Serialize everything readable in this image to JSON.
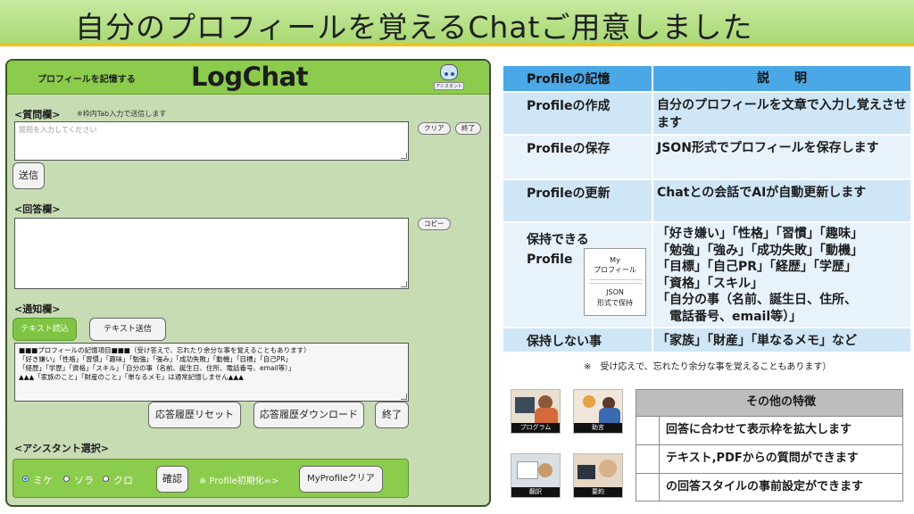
{
  "banner": {
    "title": "自分のプロフィールを覚えるChatご用意しました"
  },
  "app": {
    "subtitle": "プロフィールを記憶する",
    "logo": "LogChat",
    "avatar_tag": "アシスタント",
    "question": {
      "label": "<質問欄>",
      "hint": "※枠内Tab入力で送信します",
      "placeholder": "質問を入力してください",
      "clear_label": "クリア",
      "exit_label": "終了",
      "send_label": "送信"
    },
    "answer": {
      "label": "<回答欄>",
      "copy_label": "コピー"
    },
    "notice": {
      "label": "<通知欄>",
      "tab_read": "テキスト読込",
      "tab_send": "テキスト送信",
      "content_lines": [
        "■■■プロフィールの記憶項目■■■（受け答えで、忘れたり余分な事を覚えることもあります）",
        "「好き嫌い」「性格」「習慣」「趣味」「勉強」「強み」「成功失敗」「動機」「目標」「自己PR」",
        "「経歴」「学歴」「資格」「スキル」「自分の事（名前、誕生日、住所、電話番号、email等）」",
        "▲▲▲「家族のこと」「財産のこと」「単なるメモ」は通常記憶しません▲▲▲"
      ],
      "reset_label": "応答履歴リセット",
      "download_label": "応答履歴ダウンロード",
      "exit_label": "終了"
    },
    "assistant": {
      "label": "<アシスタント選択>",
      "options": [
        "ミケ",
        "ソラ",
        "クロ"
      ],
      "selected": "ミケ",
      "confirm_label": "確認",
      "init_note": "※ Profile初期化=>",
      "clear_label": "MyProfileクリア"
    }
  },
  "profile_table": {
    "header": {
      "col1": "Profileの記憶",
      "col2": "説　　明"
    },
    "rows": [
      {
        "col1": "Profileの作成",
        "col2": "自分のプロフィールを文章で入力し覚えさせます"
      },
      {
        "col1": "Profileの保存",
        "col2": "JSON形式でプロフィールを保存します"
      },
      {
        "col1": "Profileの更新",
        "col2": "Chatとの会話でAIが自動更新します"
      },
      {
        "col1": "保持できる\nProfile",
        "col2_lines": [
          "「好き嫌い」「性格」「習慣」「趣味」",
          "「勉強」「強み」「成功失敗」「動機」",
          "「目標」「自己PR」「経歴」「学歴」",
          "「資格」「スキル」",
          "「自分の事（名前、誕生日、住所、",
          "　電話番号、email等）」"
        ]
      },
      {
        "col1": "保持しない事",
        "col2": "「家族」「財産」「単なるメモ」など"
      }
    ],
    "json_card": {
      "line1": "My",
      "line2": "プロフィール",
      "line3": "JSON",
      "line4": "形式で保持"
    }
  },
  "footnote": "※　受け応えで、忘れたり余分な事を覚えることもあります）",
  "thumbnails": [
    "プログラム",
    "助言",
    "翻訳",
    "要約"
  ],
  "features": {
    "header": "その他の特徴",
    "items": [
      "回答に合わせて表示枠を拡大します",
      "テキスト,PDFからの質問ができます",
      "の回答スタイルの事前設定ができます"
    ]
  },
  "colors": {
    "banner_green": "#a9d973",
    "accent_yellow": "#f2c21a",
    "app_header_green": "#8ccc4c",
    "table_header_blue": "#4aa8e6",
    "table_row_blue": "#cfe6f6"
  }
}
